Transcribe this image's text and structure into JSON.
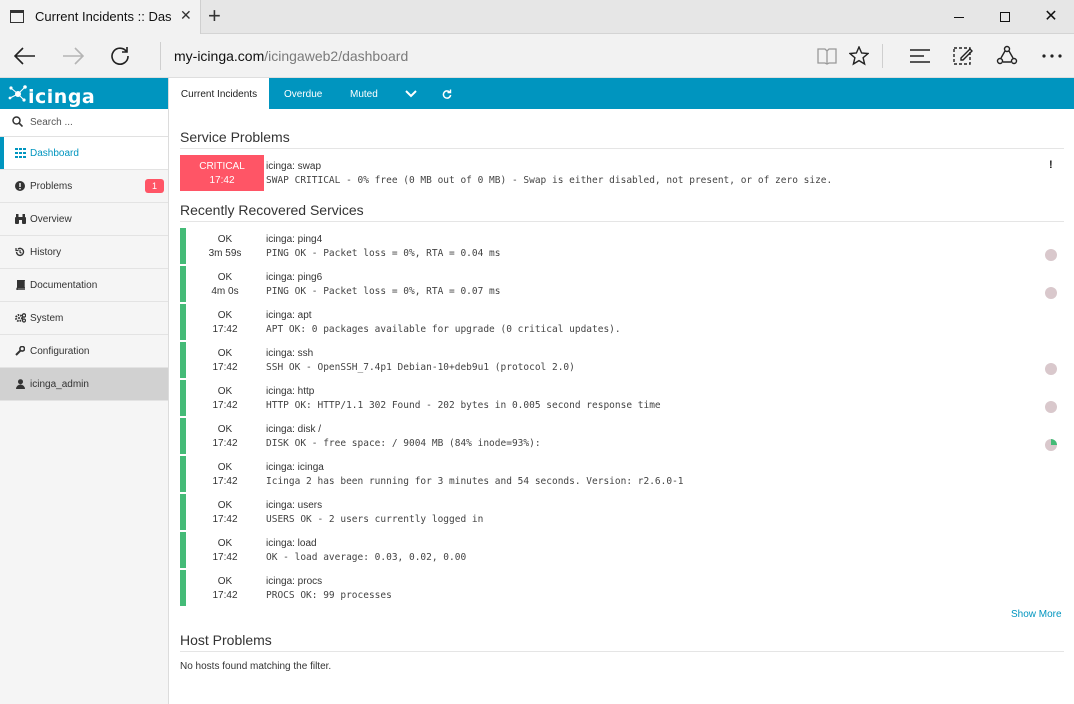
{
  "browser": {
    "tab_title": "Current Incidents :: Dash",
    "url_host": "my-icinga.com",
    "url_path": "/icingaweb2/dashboard"
  },
  "brand": {
    "logo_text": "icinga",
    "accent": "#0095bf"
  },
  "sidebar": {
    "search_placeholder": "Search ...",
    "items": [
      {
        "label": "Dashboard",
        "icon": "dashboard-grid-icon"
      },
      {
        "label": "Problems",
        "icon": "alert-circle-icon",
        "badge": "1"
      },
      {
        "label": "Overview",
        "icon": "binoculars-icon"
      },
      {
        "label": "History",
        "icon": "history-icon"
      },
      {
        "label": "Documentation",
        "icon": "book-icon"
      },
      {
        "label": "System",
        "icon": "gears-icon"
      },
      {
        "label": "Configuration",
        "icon": "wrench-icon"
      },
      {
        "label": "icinga_admin",
        "icon": "user-icon"
      }
    ]
  },
  "topnav": {
    "tabs": [
      "Current Incidents",
      "Overdue",
      "Muted"
    ]
  },
  "service_problems": {
    "heading": "Service Problems",
    "rows": [
      {
        "state": "CRITICAL",
        "time": "17:42",
        "name": "icinga: swap",
        "output": "SWAP CRITICAL - 0% free (0 MB out of 0 MB) - Swap is either disabled, not present, or of zero size.",
        "flag": "!"
      }
    ]
  },
  "recovered": {
    "heading": "Recently Recovered Services",
    "rows": [
      {
        "state": "OK",
        "time": "3m 59s",
        "name": "icinga: ping4",
        "output": "PING OK - Packet loss = 0%, RTA = 0.04 ms"
      },
      {
        "state": "OK",
        "time": "4m 0s",
        "name": "icinga: ping6",
        "output": "PING OK - Packet loss = 0%, RTA = 0.07 ms"
      },
      {
        "state": "OK",
        "time": "17:42",
        "name": "icinga: apt",
        "output": "APT OK: 0 packages available for upgrade (0 critical updates)."
      },
      {
        "state": "OK",
        "time": "17:42",
        "name": "icinga: ssh",
        "output": "SSH OK - OpenSSH_7.4p1 Debian-10+deb9u1 (protocol 2.0)"
      },
      {
        "state": "OK",
        "time": "17:42",
        "name": "icinga: http",
        "output": "HTTP OK: HTTP/1.1 302 Found - 202 bytes in 0.005 second response time"
      },
      {
        "state": "OK",
        "time": "17:42",
        "name": "icinga: disk /",
        "output": "DISK OK - free space: / 9004 MB (84% inode=93%):"
      },
      {
        "state": "OK",
        "time": "17:42",
        "name": "icinga: icinga",
        "output": "Icinga 2 has been running for 3 minutes and 54 seconds. Version: r2.6.0-1"
      },
      {
        "state": "OK",
        "time": "17:42",
        "name": "icinga: users",
        "output": "USERS OK - 2 users currently logged in"
      },
      {
        "state": "OK",
        "time": "17:42",
        "name": "icinga: load",
        "output": "OK - load average: 0.03, 0.02, 0.00"
      },
      {
        "state": "OK",
        "time": "17:42",
        "name": "icinga: procs",
        "output": "PROCS OK: 99 processes"
      }
    ],
    "show_more": "Show More"
  },
  "host_problems": {
    "heading": "Host Problems",
    "empty_text": "No hosts found matching the filter."
  }
}
